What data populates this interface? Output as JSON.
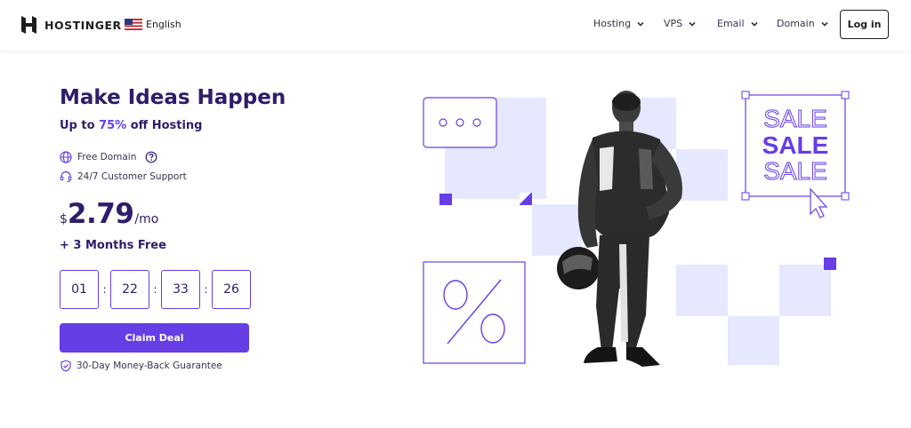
{
  "header": {
    "brand": "HOSTINGER",
    "language": "English",
    "nav": [
      {
        "label": "Hosting",
        "icon": "chevron-down-icon"
      },
      {
        "label": "VPS",
        "icon": "chevron-down-icon"
      },
      {
        "label": "Email",
        "icon": "chevron-down-icon"
      },
      {
        "label": "Domain",
        "icon": "chevron-down-icon"
      }
    ],
    "login_label": "Log in"
  },
  "hero": {
    "title": "Make Ideas Happen",
    "subtitle_prefix": "Up to ",
    "subtitle_highlight": "75%",
    "subtitle_suffix": " off Hosting",
    "features": [
      {
        "label": "Free Domain",
        "icon": "globe-icon",
        "info_icon": "help-circle-icon"
      },
      {
        "label": "24/7 Customer Support",
        "icon": "headset-icon"
      }
    ],
    "price": {
      "currency": "$",
      "amount": "2.79",
      "period": "/mo"
    },
    "bonus": "+ 3 Months Free",
    "countdown": [
      "01",
      "22",
      "33",
      "26"
    ],
    "countdown_separator": ":",
    "cta_label": "Claim Deal",
    "guarantee": "30-Day Money-Back Guarantee",
    "guarantee_icon": "shield-check-icon",
    "sale_words": [
      "SALE",
      "SALE",
      "SALE"
    ],
    "percent_symbol": "%"
  },
  "colors": {
    "brand": "#673de6",
    "text_dark": "#2f1c6a",
    "tile": "#e5e8fe"
  }
}
